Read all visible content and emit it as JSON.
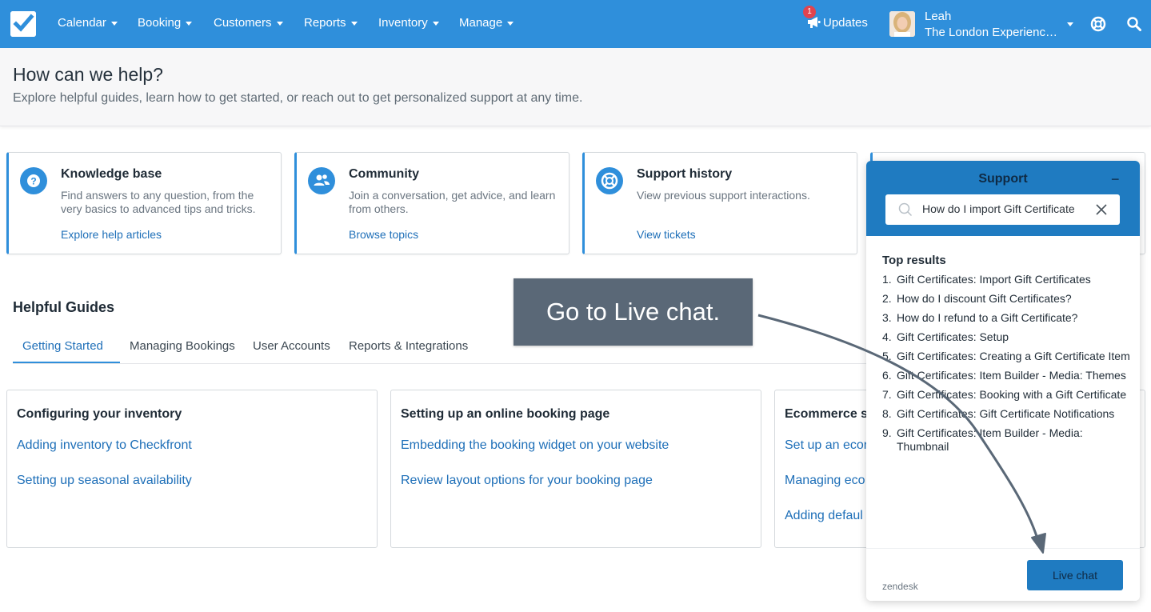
{
  "nav": {
    "items": [
      {
        "label": "Calendar"
      },
      {
        "label": "Booking"
      },
      {
        "label": "Customers"
      },
      {
        "label": "Reports"
      },
      {
        "label": "Inventory"
      },
      {
        "label": "Manage"
      }
    ],
    "updates_label": "Updates",
    "updates_badge": "1",
    "user_name": "Leah",
    "user_org": "The London Experienc…"
  },
  "header": {
    "title": "How can we help?",
    "subtitle": "Explore helpful guides, learn how to get started, or reach out to get personalized support at any time."
  },
  "cards": [
    {
      "title": "Knowledge base",
      "description": "Find answers to any question, from the very basics to advanced tips and tricks.",
      "link": "Explore help articles"
    },
    {
      "title": "Community",
      "description": "Join a conversation, get advice, and learn from others.",
      "link": "Browse topics"
    },
    {
      "title": "Support history",
      "description": "View previous support interactions.",
      "link": "View tickets"
    }
  ],
  "guides": {
    "title": "Helpful Guides",
    "tabs": [
      {
        "label": "Getting Started"
      },
      {
        "label": "Managing Bookings"
      },
      {
        "label": "User Accounts"
      },
      {
        "label": "Reports & Integrations"
      }
    ],
    "sections": [
      {
        "title": "Configuring your inventory",
        "links": [
          "Adding inventory to Checkfront",
          "Setting up seasonal availability"
        ]
      },
      {
        "title": "Setting up an online booking page",
        "links": [
          "Embedding the booking widget on your website",
          "Review layout options for your booking page"
        ]
      },
      {
        "title": "Ecommerce s",
        "links": [
          "Set up an ecor",
          "Managing eco",
          "Adding defaul"
        ]
      }
    ]
  },
  "callout": {
    "text": "Go to Live chat."
  },
  "support": {
    "title": "Support",
    "minimize": "−",
    "search_value": "How do I import Gift Certificate",
    "results_title": "Top results",
    "results": [
      {
        "num": "1.",
        "text": "Gift Certificates: Import Gift Certificates"
      },
      {
        "num": "2.",
        "text": "How do I discount Gift Certificates?"
      },
      {
        "num": "3.",
        "text": "How do I refund to a Gift Certificate?"
      },
      {
        "num": "4.",
        "text": "Gift Certificates: Setup"
      },
      {
        "num": "5.",
        "text": "Gift Certificates: Creating a Gift Certificate Item"
      },
      {
        "num": "6.",
        "text": "Gift Certificates: Item Builder - Media: Themes"
      },
      {
        "num": "7.",
        "text": "Gift Certificates: Booking with a Gift Certificate"
      },
      {
        "num": "8.",
        "text": "Gift Certificates: Gift Certificate Notifications"
      },
      {
        "num": "9.",
        "text": "Gift Certificates: Item Builder - Media: Thumbnail"
      }
    ],
    "brand": "zendesk",
    "live_chat_label": "Live chat"
  },
  "colors": {
    "brand_blue": "#2f8fdb",
    "link_blue": "#1e6fb8",
    "support_header": "#1f7bc1",
    "callout": "#5a6877",
    "badge_red": "#e0434e"
  },
  "icons": {
    "logo": "checkbox-logo-icon",
    "updates": "megaphone-icon",
    "help": "lifebuoy-icon",
    "search": "search-icon",
    "knowledge": "question-circle-icon",
    "community": "users-icon",
    "history": "lifebuoy-icon"
  }
}
